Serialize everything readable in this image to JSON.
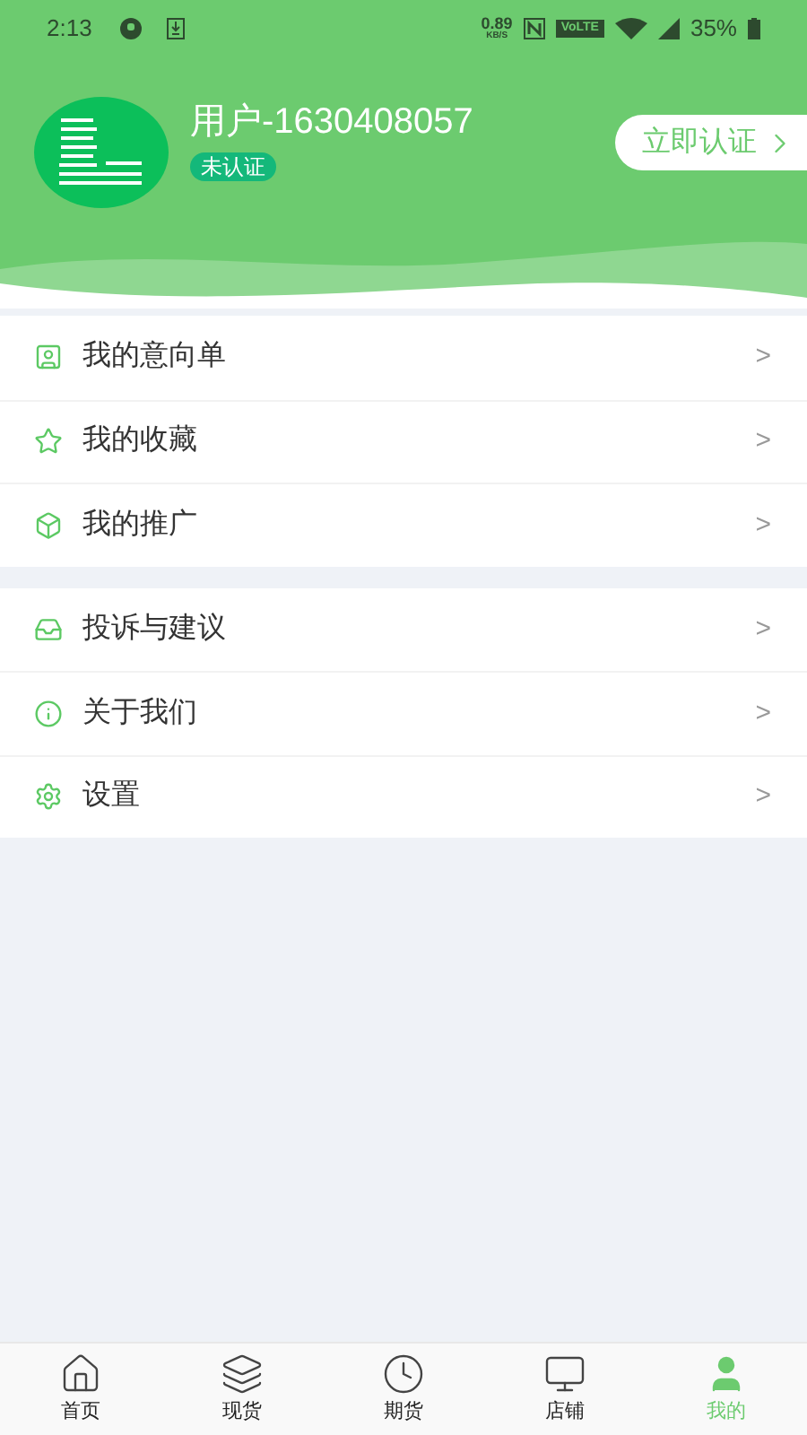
{
  "status_bar": {
    "time": "2:13",
    "speed": "0.89",
    "speed_unit": "KB/S",
    "network": "VoLTE",
    "battery": "35%"
  },
  "profile": {
    "name": "用户-1630408057",
    "badge": "未认证",
    "action": "立即认证"
  },
  "menu_groups": [
    {
      "items": [
        {
          "kind": "order",
          "label": "我的意向单",
          "chevron": ">"
        },
        {
          "kind": "favorite",
          "label": "我的收藏",
          "chevron": ">"
        },
        {
          "kind": "promote",
          "label": "我的推广",
          "chevron": ">"
        }
      ]
    },
    {
      "items": [
        {
          "kind": "feedback",
          "label": "投诉与建议",
          "chevron": ">"
        },
        {
          "kind": "about",
          "label": "关于我们",
          "chevron": ">"
        },
        {
          "kind": "settings",
          "label": "设置",
          "chevron": ">"
        }
      ]
    }
  ],
  "tabs": [
    {
      "kind": "home",
      "label": "首页",
      "selected": false
    },
    {
      "kind": "stock",
      "label": "现货",
      "selected": false
    },
    {
      "kind": "futures",
      "label": "期货",
      "selected": false
    },
    {
      "kind": "store",
      "label": "店铺",
      "selected": false
    },
    {
      "kind": "me",
      "label": "我的",
      "selected": true
    }
  ]
}
